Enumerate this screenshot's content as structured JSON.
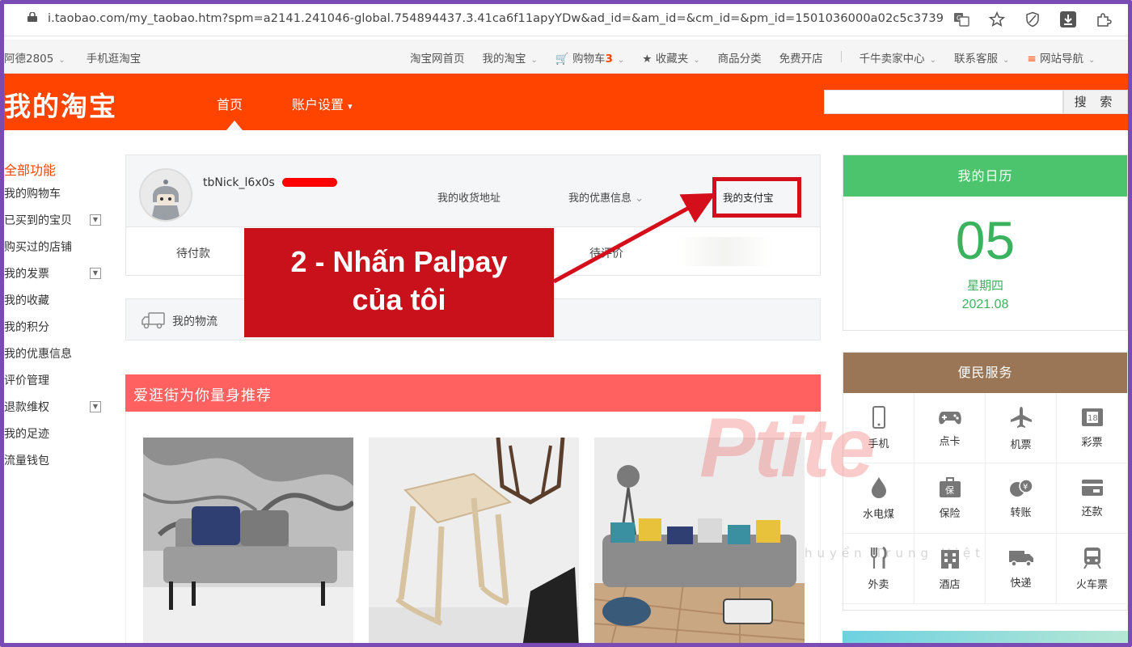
{
  "browser": {
    "url": "i.taobao.com/my_taobao.htm?spm=a2141.241046-global.754894437.3.41ca6f11apyYDw&ad_id=&am_id=&cm_id=&pm_id=1501036000a02c5c3739",
    "icons": [
      "lock-icon",
      "translate-icon",
      "star-icon",
      "shield-icon",
      "download-icon",
      "extension-icon"
    ]
  },
  "sitenav": {
    "left": [
      "阿德2805",
      "手机逛淘宝"
    ],
    "home": "淘宝网首页",
    "my_taobao": "我的淘宝",
    "cart": "购物车",
    "cart_count": "3",
    "favorites": "收藏夹",
    "categories": "商品分类",
    "open_shop": "免费开店",
    "seller_center": "千牛卖家中心",
    "support": "联系客服",
    "site_nav": "网站导航"
  },
  "header": {
    "logo": "我的淘宝",
    "nav_home": "首页",
    "nav_account": "账户设置",
    "search_button": "搜 索",
    "search_placeholder": ""
  },
  "sidebar": {
    "title": "全部功能",
    "items": [
      "我的购物车",
      "已买到的宝贝",
      "购买过的店铺",
      "我的发票",
      "我的收藏",
      "我的积分",
      "我的优惠信息",
      "评价管理",
      "退款维权",
      "我的足迹",
      "流量钱包"
    ]
  },
  "profile": {
    "username": "tbNick_l6x0s",
    "address": "我的收货地址",
    "coupons": "我的优惠信息",
    "alipay": "我的支付宝",
    "pending_pay": "待付款",
    "pending_review": "待评价"
  },
  "logistics": {
    "label": "我的物流"
  },
  "recommend": {
    "title": "爱逛街为你量身推荐"
  },
  "calendar": {
    "title": "我的日历",
    "day": "05",
    "weekday": "星期四",
    "year_month": "2021.08"
  },
  "services": {
    "title": "便民服务",
    "items": [
      {
        "label": "手机",
        "icon": "phone-icon"
      },
      {
        "label": "点卡",
        "icon": "gamepad-icon"
      },
      {
        "label": "机票",
        "icon": "airplane-icon"
      },
      {
        "label": "彩票",
        "icon": "lottery-icon"
      },
      {
        "label": "水电煤",
        "icon": "water-drop-icon"
      },
      {
        "label": "保险",
        "icon": "insurance-icon"
      },
      {
        "label": "转账",
        "icon": "transfer-icon"
      },
      {
        "label": "还款",
        "icon": "repay-icon"
      },
      {
        "label": "外卖",
        "icon": "fork-knife-icon"
      },
      {
        "label": "酒店",
        "icon": "hotel-icon"
      },
      {
        "label": "快递",
        "icon": "truck-icon"
      },
      {
        "label": "火车票",
        "icon": "train-icon"
      }
    ]
  },
  "callout": {
    "line1": "2 - Nhấn Palpay",
    "line2": "của tôi"
  },
  "watermark": {
    "brand": "Ptite",
    "tagline": "huyển Trung Việt"
  },
  "colors": {
    "header_orange": "#ff4400",
    "calendar_green": "#4cc46e",
    "services_brown": "#9a7657",
    "recommend_red": "#ff6060",
    "callout_red": "#c8111b"
  }
}
